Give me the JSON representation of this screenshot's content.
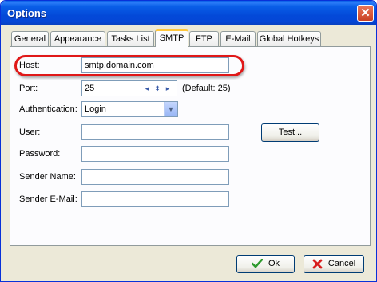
{
  "window": {
    "title": "Options",
    "close_glyph": "✕"
  },
  "tabs": [
    {
      "label": "General"
    },
    {
      "label": "Appearance"
    },
    {
      "label": "Tasks List"
    },
    {
      "label": "SMTP",
      "active": true
    },
    {
      "label": "FTP"
    },
    {
      "label": "E-Mail"
    },
    {
      "label": "Global Hotkeys"
    }
  ],
  "form": {
    "host": {
      "label": "Host:",
      "value": "smtp.domain.com"
    },
    "port": {
      "label": "Port:",
      "value": "25",
      "hint": "(Default: 25)"
    },
    "authentication": {
      "label": "Authentication:",
      "value": "Login"
    },
    "user": {
      "label": "User:",
      "value": ""
    },
    "password": {
      "label": "Password:",
      "value": ""
    },
    "sender_name": {
      "label": "Sender Name:",
      "value": ""
    },
    "sender_email": {
      "label": "Sender E-Mail:",
      "value": ""
    },
    "test_button": "Test..."
  },
  "footer": {
    "ok_label": "Ok",
    "cancel_label": "Cancel"
  },
  "icons": {
    "ok": "checkmark-icon",
    "cancel": "red-x-icon",
    "spin": [
      "spin-left-icon",
      "spin-up-icon",
      "spin-down-icon",
      "spin-right-icon"
    ],
    "dropdown": "chevron-down-icon"
  },
  "colors": {
    "titlebar": "#0a5fe8",
    "highlight_ring": "#e01818",
    "active_tab_accent": "#ffc73c"
  }
}
